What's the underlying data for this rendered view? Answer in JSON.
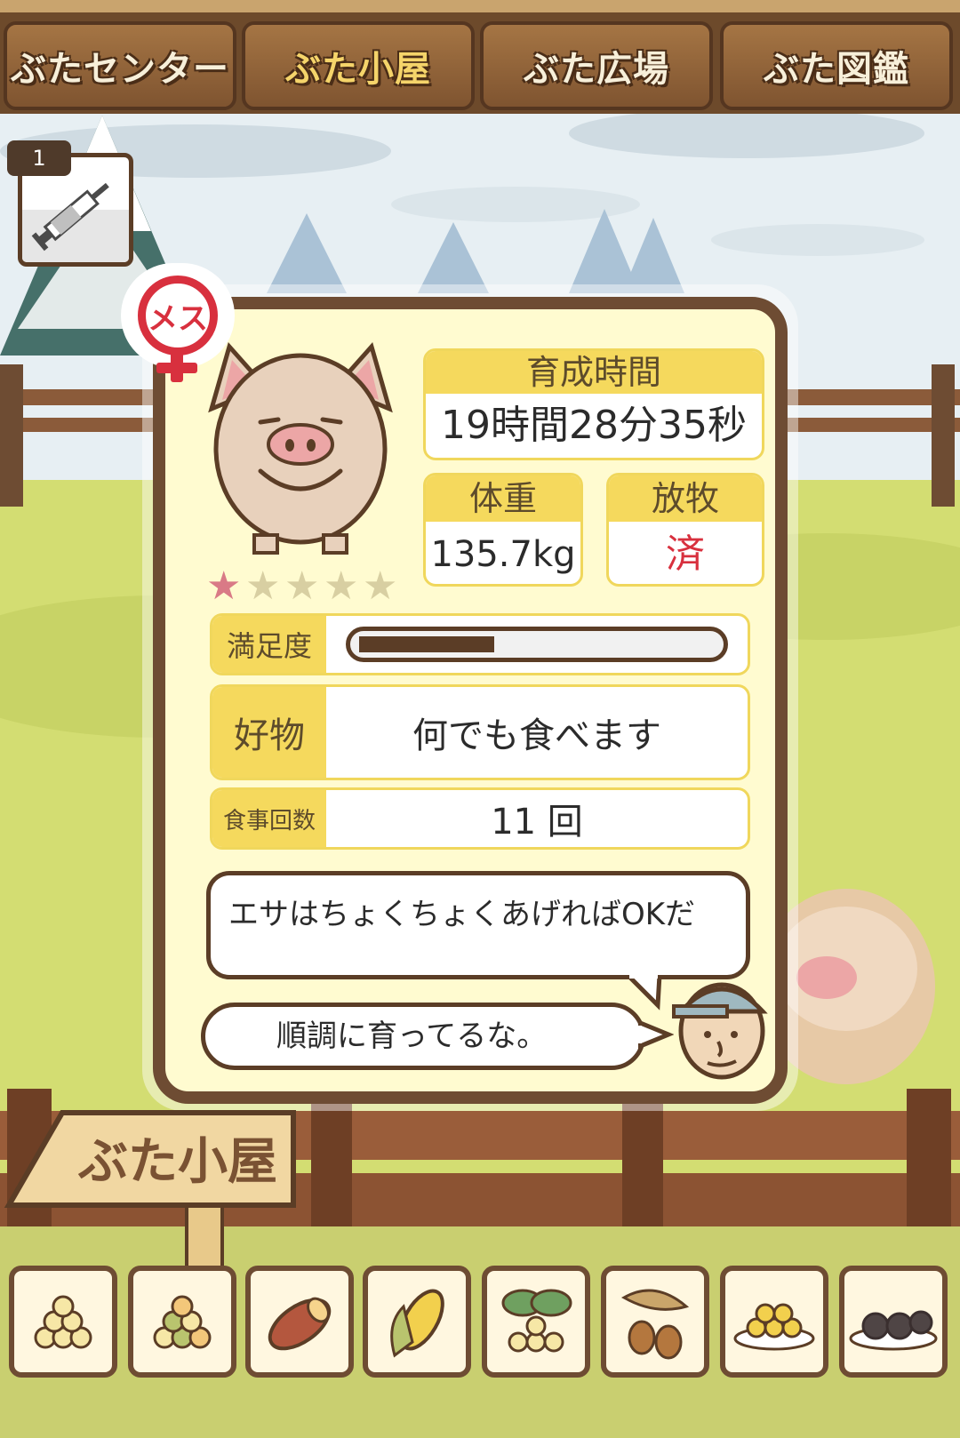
{
  "nav": {
    "tabs": [
      {
        "label": "ぶたセンター"
      },
      {
        "label": "ぶた小屋"
      },
      {
        "label": "ぶた広場"
      },
      {
        "label": "ぶた図鑑"
      }
    ],
    "active_tab": "ぶた小屋"
  },
  "item_badge": {
    "count": "1",
    "icon": "syringe-icon"
  },
  "pig": {
    "gender_label": "メス",
    "rating": 1,
    "rating_max": 5,
    "growth_time_label": "育成時間",
    "growth_time_value": "19時間28分35秒",
    "weight_label": "体重",
    "weight_value": "135.7kg",
    "grazing_label": "放牧",
    "grazing_value": "済",
    "satisfaction_label": "満足度",
    "satisfaction_level": 0.38,
    "favorite_label": "好物",
    "favorite_value": "何でも食べます",
    "meals_label": "食事回数",
    "meals_value": "11 回"
  },
  "tips": {
    "advice": "エサはちょくちょくあげればOKだ",
    "comment": "順調に育ってるな。"
  },
  "sign": {
    "label": "ぶた小屋"
  },
  "food_items": [
    {
      "icon": "soybeans-icon"
    },
    {
      "icon": "mixed-beans-icon"
    },
    {
      "icon": "sweet-potato-icon"
    },
    {
      "icon": "corn-icon"
    },
    {
      "icon": "beans-and-leaves-icon"
    },
    {
      "icon": "acorns-icon"
    },
    {
      "icon": "beans-plate-icon"
    },
    {
      "icon": "dark-balls-plate-icon"
    }
  ],
  "colors": {
    "wood": "#6e4c33",
    "panel": "#fffbd0",
    "header_yellow": "#f5d95d",
    "accent_red": "#d8303e",
    "grass": "#d3dd72"
  }
}
